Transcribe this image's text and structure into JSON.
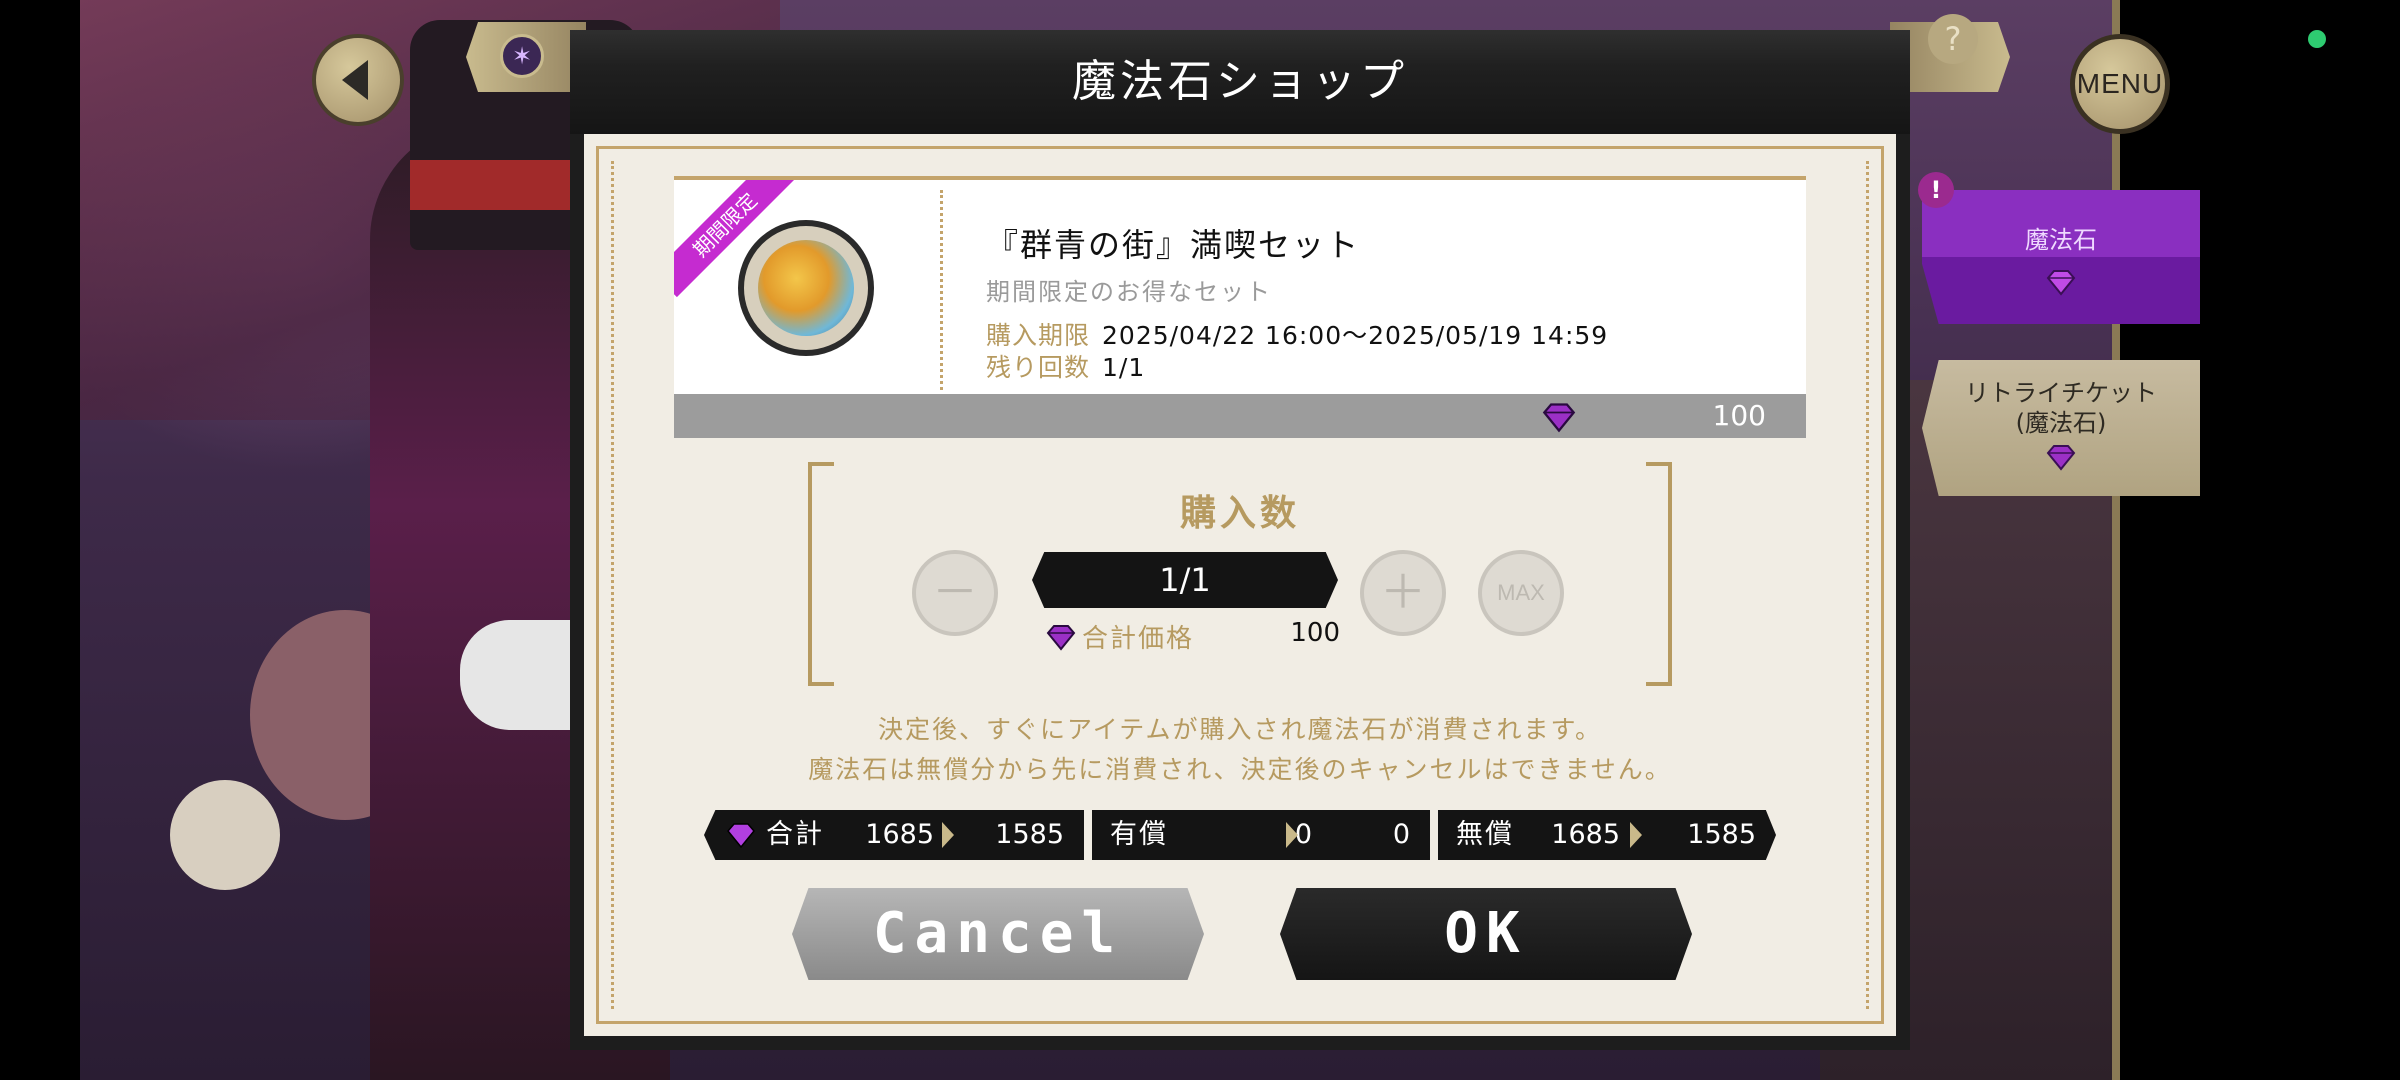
{
  "modal": {
    "title": "魔法石ショップ",
    "item": {
      "ribbon": "期間限定",
      "name": "『群青の街』満喫セット",
      "subtitle": "期間限定のお得なセット",
      "period_label": "購入期限",
      "period_value": "2025/04/22 16:00～2025/05/19 14:59",
      "remaining_label": "残り回数",
      "remaining_value": "1/1",
      "price": "100"
    },
    "quantity": {
      "title": "購入数",
      "display": "1/1",
      "minus": "－",
      "plus": "＋",
      "max": "MAX",
      "total_label": "合計価格",
      "total_value": "100"
    },
    "notice": [
      "決定後、すぐにアイテムが購入され魔法石が消費されます。",
      "魔法石は無償分から先に消費され、決定後のキャンセルはできません。"
    ],
    "balance": {
      "total_label": "合計",
      "total_from": "1685",
      "total_to": "1585",
      "paid_label": "有償",
      "paid_from": "0",
      "paid_to": "0",
      "free_label": "無償",
      "free_from": "1685",
      "free_to": "1585"
    },
    "buttons": {
      "cancel": "Cancel",
      "ok": "OK"
    }
  },
  "hud": {
    "menu": "MENU",
    "help": "?"
  },
  "side_tabs": [
    {
      "label": "魔法石",
      "active": true
    },
    {
      "label_line1": "リトライチケット",
      "label_line2": "(魔法石)",
      "active": false
    }
  ],
  "colors": {
    "gold": "#b69a60",
    "gem": "#8a2fc0",
    "ribbon": "#c52bd0",
    "status_dot": "#2ecc71"
  },
  "icons": [
    "back-arrow-icon",
    "gem-icon",
    "help-icon",
    "menu-button",
    "alert-icon"
  ]
}
